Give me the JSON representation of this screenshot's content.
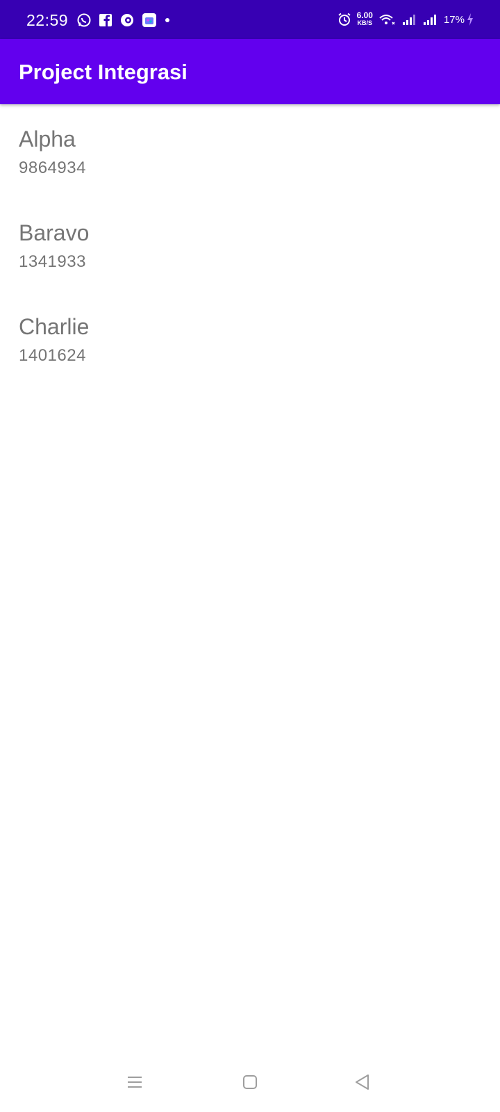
{
  "status_bar": {
    "time": "22:59",
    "notification_icons": [
      "whatsapp-icon",
      "facebook-icon",
      "messenger-icon",
      "store-icon"
    ],
    "net_speed_value": "6.00",
    "net_speed_unit": "KB/S",
    "battery_percent": "17%",
    "background_color": "#3700b3"
  },
  "app_bar": {
    "title": "Project Integrasi",
    "background_color": "#6200ee"
  },
  "contacts": [
    {
      "name": "Alpha",
      "number": "9864934"
    },
    {
      "name": "Baravo",
      "number": "1341933"
    },
    {
      "name": "Charlie",
      "number": "1401624"
    }
  ],
  "navigation": {
    "buttons": [
      "menu-icon",
      "home-icon",
      "back-icon"
    ]
  }
}
